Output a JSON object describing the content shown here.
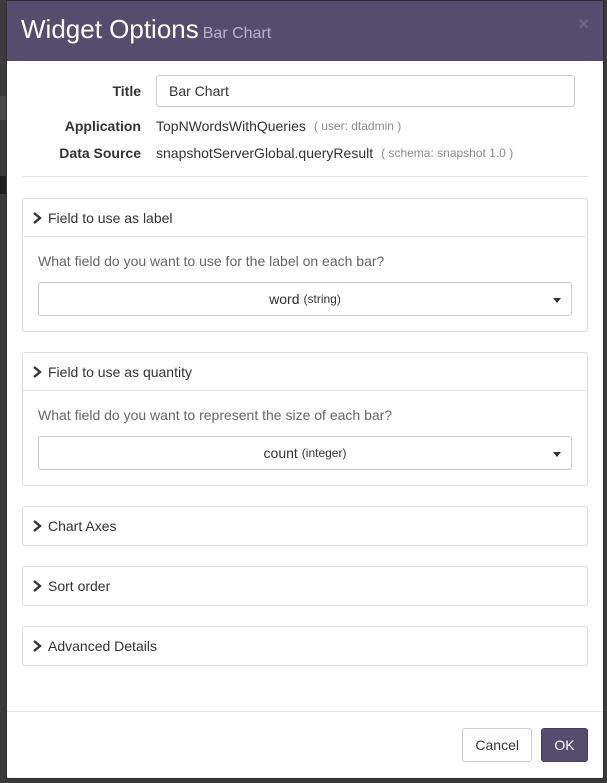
{
  "colors": {
    "header_bg": "#564c6e",
    "ok_button_bg": "#564c6e",
    "page_backdrop": "#3a3a3a"
  },
  "modal": {
    "title": "Widget Options",
    "subtitle": "Bar Chart",
    "close_symbol": "×"
  },
  "info": {
    "title_label": "Title",
    "title_value": "Bar Chart",
    "application_label": "Application",
    "application_value": "TopNWordsWithQueries",
    "application_note": "( user: dtadmin )",
    "datasource_label": "Data Source",
    "datasource_value": "snapshotServerGlobal.queryResult",
    "datasource_note": "( schema: snapshot 1.0 )"
  },
  "panels": [
    {
      "title": "Field to use as label",
      "expanded": true,
      "question": "What field do you want to use for the label on each bar?",
      "select_value": "word",
      "select_type": "(string)"
    },
    {
      "title": "Field to use as quantity",
      "expanded": true,
      "question": "What field do you want to represent the size of each bar?",
      "select_value": "count",
      "select_type": "(integer)"
    },
    {
      "title": "Chart Axes",
      "expanded": false
    },
    {
      "title": "Sort order",
      "expanded": false
    },
    {
      "title": "Advanced Details",
      "expanded": false
    }
  ],
  "icons": {
    "panel_toggle": "chevron-right-icon",
    "select_caret": "caret-down-icon",
    "close": "close-icon"
  },
  "footer": {
    "cancel_label": "Cancel",
    "ok_label": "OK"
  }
}
